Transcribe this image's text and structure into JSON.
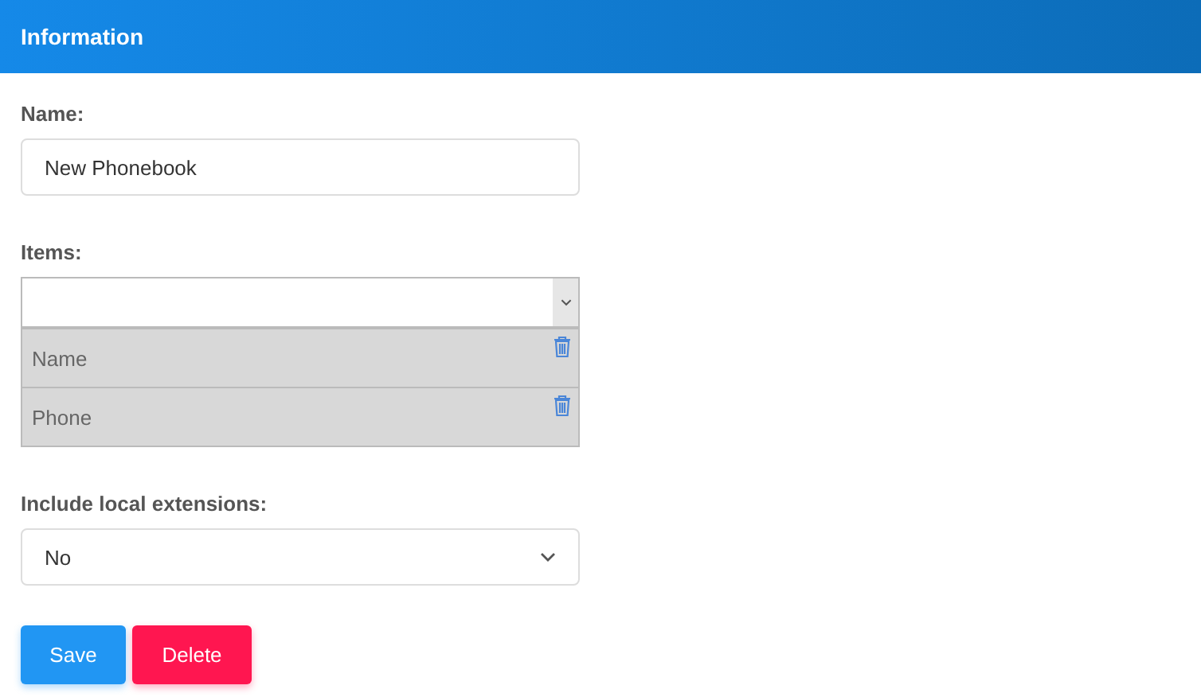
{
  "header": {
    "title": "Information"
  },
  "name_field": {
    "label": "Name:",
    "value": "New Phonebook"
  },
  "items": {
    "label": "Items:",
    "entries": [
      {
        "text": "Name"
      },
      {
        "text": "Phone"
      }
    ]
  },
  "local_extensions": {
    "label": "Include local extensions:",
    "value": "No"
  },
  "buttons": [
    {
      "label": "Save",
      "kind": "primary"
    },
    {
      "label": "Delete",
      "kind": "danger"
    }
  ]
}
